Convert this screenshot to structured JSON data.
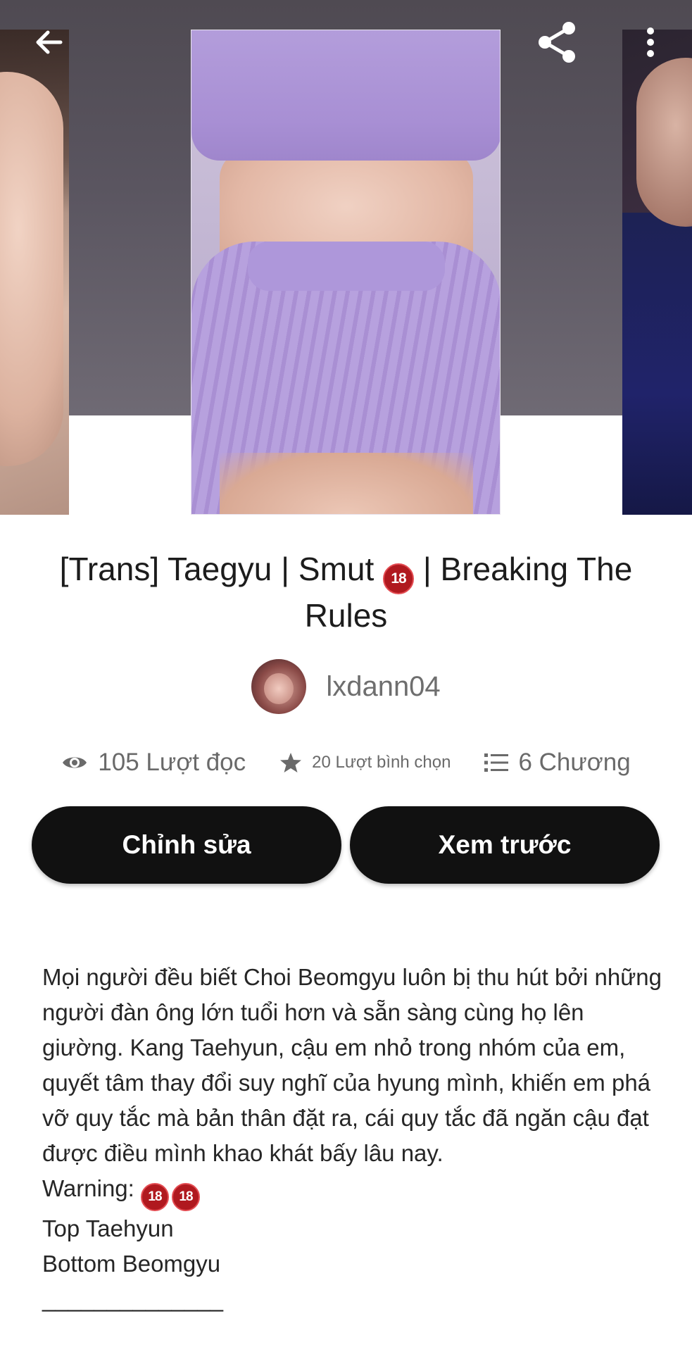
{
  "toolbar": {
    "back_icon": "arrow-left-icon",
    "share_icon": "share-icon",
    "more_icon": "more-vertical-icon"
  },
  "story": {
    "title_before": "[Trans] Taegyu | Smut",
    "title_badge": "18",
    "title_after": "| Breaking The Rules",
    "author": "lxdann04"
  },
  "stats": {
    "reads": "105 Lượt đọc",
    "votes": "20 Lượt bình chọn",
    "parts": "6 Chương"
  },
  "buttons": {
    "edit": "Chỉnh sửa",
    "preview": "Xem trước"
  },
  "description": {
    "paragraph": "Mọi người đều biết Choi Beomgyu luôn bị thu hút bởi những người đàn ông lớn tuổi hơn và sẵn sàng cùng họ lên giường. Kang Taehyun, cậu em nhỏ trong nhóm của em, quyết tâm thay đổi suy nghĩ của hyung mình, khiến em phá vỡ quy tắc mà bản thân đặt ra, cái quy tắc đã ngăn cậu đạt được điều mình khao khát bấy lâu nay.",
    "warning_label": "Warning:",
    "warning_badges": [
      "18",
      "18"
    ],
    "top_line": "Top Taehyun",
    "bottom_line": "Bottom Beomgyu",
    "separator": "______________"
  },
  "colors": {
    "button_bg": "#111111",
    "badge_red": "#b0191f",
    "header_bg": "#4f4a52"
  }
}
